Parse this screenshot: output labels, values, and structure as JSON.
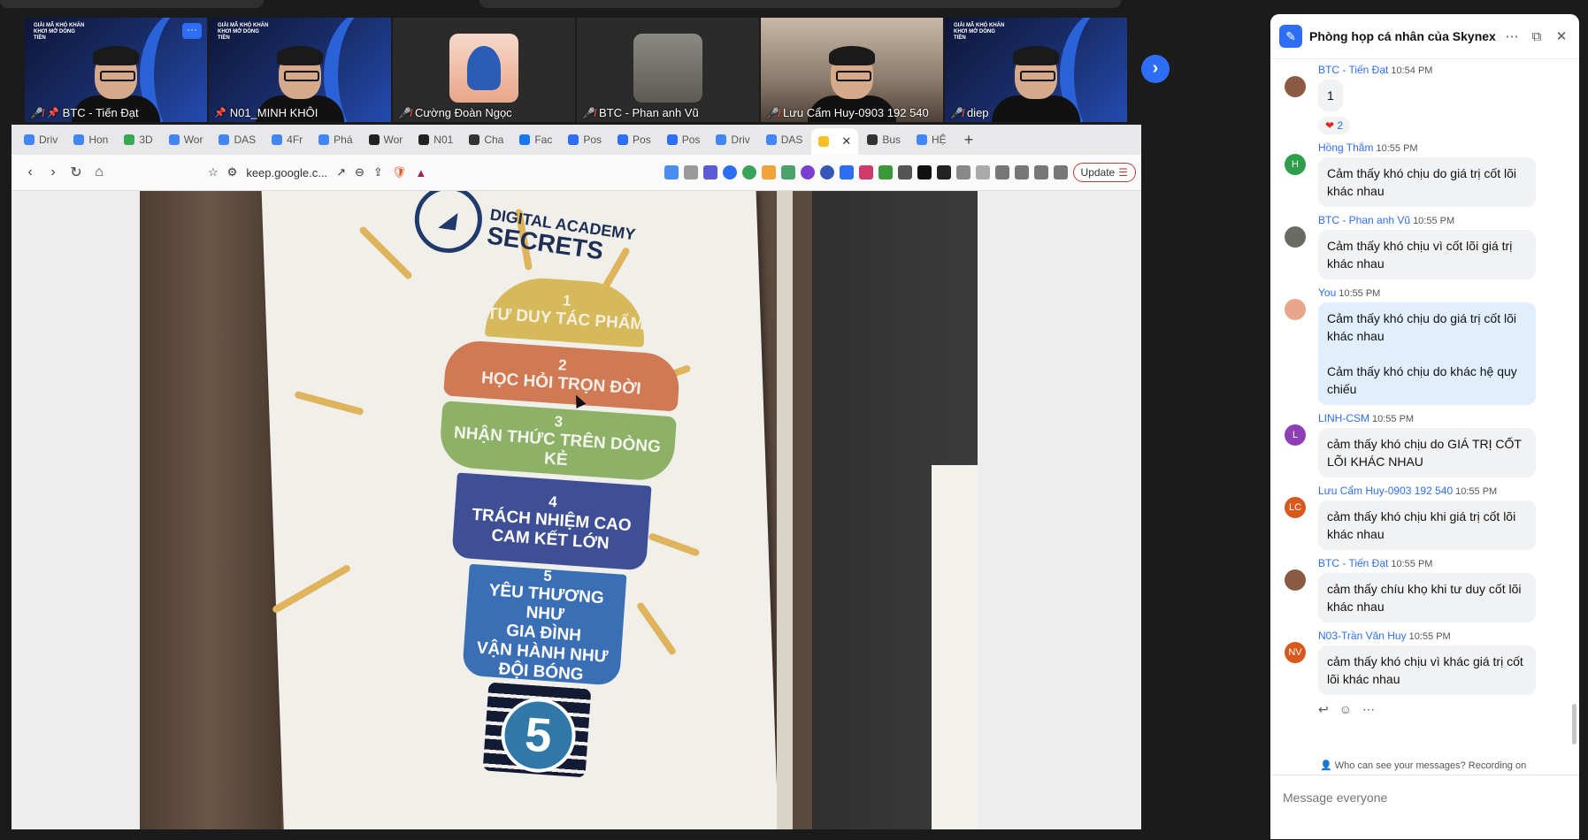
{
  "video_strip": {
    "tiles": [
      {
        "name": "BTC - Tiến Đạt",
        "muted": true,
        "pinned": true,
        "brand": "GIẢI MÃ KHÓ KHĂN KHƠI MỞ DÒNG TIỀN"
      },
      {
        "name": "N01_MINH KHÔI",
        "muted": false,
        "pinned": true,
        "brand": "GIẢI MÃ KHÓ KHĂN KHƠI MỞ DÒNG TIỀN"
      },
      {
        "name": "Cường Đoàn Ngọc",
        "muted": true,
        "pinned": false
      },
      {
        "name": "BTC - Phan anh Vũ",
        "muted": true,
        "pinned": false
      },
      {
        "name": "Lưu Cẩm Huy-0903 192 540",
        "muted": true,
        "pinned": false
      },
      {
        "name": "diep",
        "muted": true,
        "pinned": false,
        "brand": "GIẢI MÃ KHÓ KHĂN KHƠI MỞ DÒNG TIỀN"
      }
    ],
    "more_label": "···",
    "next_label": "›"
  },
  "browser": {
    "tabs": [
      {
        "label": "Driv",
        "color": "#4285f4"
      },
      {
        "label": "Hon",
        "color": "#4285f4"
      },
      {
        "label": "3D",
        "color": "#34a853"
      },
      {
        "label": "Wor",
        "color": "#4285f4"
      },
      {
        "label": "DAS",
        "color": "#4285f4"
      },
      {
        "label": "4Fr",
        "color": "#4285f4"
      },
      {
        "label": "Phá",
        "color": "#4285f4"
      },
      {
        "label": "Wor",
        "color": "#222222"
      },
      {
        "label": "N01",
        "color": "#222222"
      },
      {
        "label": "Cha",
        "color": "#333333"
      },
      {
        "label": "Fac",
        "color": "#1877f2"
      },
      {
        "label": "Pos",
        "color": "#2d6ef5"
      },
      {
        "label": "Pos",
        "color": "#2d6ef5"
      },
      {
        "label": "Pos",
        "color": "#2d6ef5"
      },
      {
        "label": "Driv",
        "color": "#4285f4"
      },
      {
        "label": "DAS",
        "color": "#4285f4"
      }
    ],
    "active_tab": {
      "label": "",
      "color": "#f6c026",
      "close": "✕"
    },
    "tabs_after": [
      {
        "label": "Bus",
        "color": "#333333"
      },
      {
        "label": "HỆ",
        "color": "#4285f4"
      }
    ],
    "new_tab": "+",
    "url": "keep.google.c...",
    "update_label": "Update",
    "nav": {
      "back": "‹",
      "forward": "›",
      "reload": "↻",
      "home": "⌂"
    }
  },
  "poster": {
    "logo_line1": "DIGITAL ACADEMY",
    "logo_line2": "SECRETS",
    "bands": [
      {
        "num": "1",
        "text": "TƯ DUY TÁC PHẨM"
      },
      {
        "num": "2",
        "text": "HỌC HỎI TRỌN ĐỜI"
      },
      {
        "num": "3",
        "text": "NHẬN THỨC TRÊN DÒNG KẺ"
      },
      {
        "num": "4",
        "text": "TRÁCH NHIỆM CAO\nCAM KẾT LỚN"
      },
      {
        "num": "5",
        "text": "YÊU THƯƠNG NHƯ\nGIA ĐÌNH\nVẬN HÀNH NHƯ\nĐỘI BÓNG"
      }
    ],
    "base_number": "5"
  },
  "chat": {
    "title": "Phòng họp cá nhân của Skynext....",
    "messages": [
      {
        "sender": "BTC - Tiến Đạt",
        "time": "10:54 PM",
        "text": "1",
        "avatar": "",
        "avatar_color": "#8a5a44",
        "reaction": "2"
      },
      {
        "sender": "Hồng Thắm",
        "time": "10:55 PM",
        "text": "Cảm thấy khó chịu do giá trị cốt lõi khác nhau",
        "avatar": "H",
        "avatar_color": "#2e9e4a"
      },
      {
        "sender": "BTC - Phan anh Vũ",
        "time": "10:55 PM",
        "text": "Cảm thấy khó chịu vì cốt lõi giá trị khác nhau",
        "avatar": "",
        "avatar_color": "#6b6b63"
      },
      {
        "sender": "You",
        "time": "10:55 PM",
        "text": "Cảm thấy khó chịu do giá trị cốt lõi khác nhau\n\nCảm thấy khó chịu do khác hệ quy chiếu",
        "avatar": "",
        "avatar_color": "#e8a68a",
        "mine": true
      },
      {
        "sender": "LINH-CSM",
        "time": "10:55 PM",
        "text": " cảm thấy khó chịu do GIÁ TRỊ CỐT LÕI KHÁC NHAU",
        "avatar": "L",
        "avatar_color": "#8e3fb6"
      },
      {
        "sender": "Lưu Cẩm Huy-0903 192 540",
        "time": "10:55 PM",
        "text": "cảm thấy khó chịu khi giá trị cốt lõi khác nhau",
        "avatar": "LC",
        "avatar_color": "#d9591c"
      },
      {
        "sender": "BTC - Tiến Đạt",
        "time": "10:55 PM",
        "text": "cảm thấy chíu khọ khi tư duy cốt lõi khác nhau",
        "avatar": "",
        "avatar_color": "#8a5a44"
      },
      {
        "sender": "N03-Trần Văn Huy",
        "time": "10:55 PM",
        "text": "cảm thấy khó chịu vì khác giá trị cốt lõi khác nhau",
        "avatar": "NV",
        "avatar_color": "#d9591c"
      }
    ],
    "notice": "Who can see your messages? Recording on",
    "composer_placeholder": "Message everyone"
  }
}
